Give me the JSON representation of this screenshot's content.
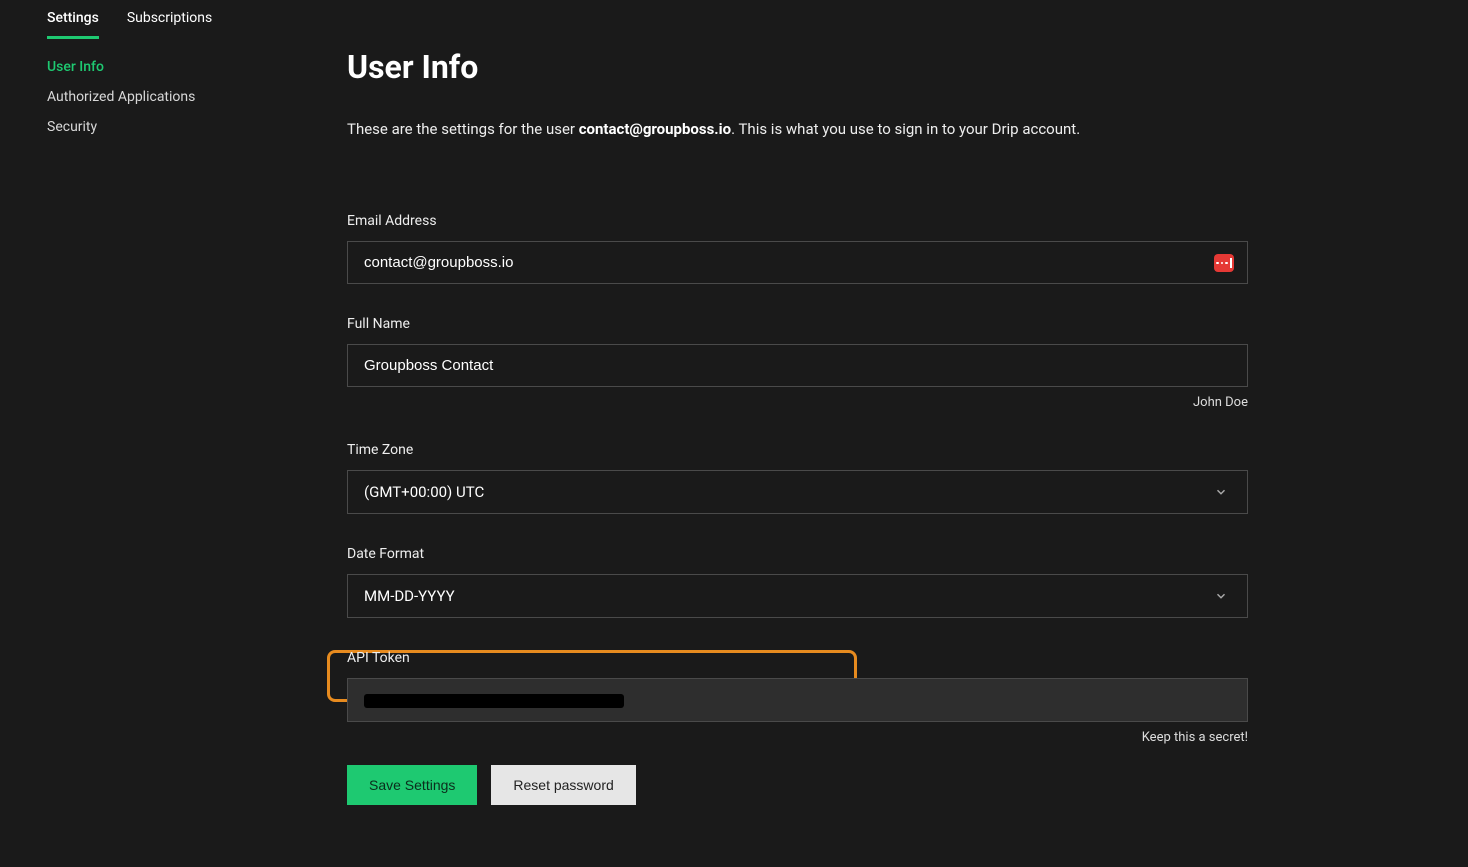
{
  "tabs": {
    "settings": "Settings",
    "subscriptions": "Subscriptions"
  },
  "sidebar": {
    "items": [
      {
        "label": "User Info",
        "active": true
      },
      {
        "label": "Authorized Applications",
        "active": false
      },
      {
        "label": "Security",
        "active": false
      }
    ]
  },
  "page": {
    "title": "User Info",
    "intro_prefix": "These are the settings for the user ",
    "intro_email": "contact@groupboss.io",
    "intro_suffix": ". This is what you use to sign in to your Drip account."
  },
  "fields": {
    "email": {
      "label": "Email Address",
      "value": "contact@groupboss.io"
    },
    "name": {
      "label": "Full Name",
      "value": "Groupboss Contact",
      "helper": "John Doe"
    },
    "timezone": {
      "label": "Time Zone",
      "value": "(GMT+00:00) UTC"
    },
    "dateformat": {
      "label": "Date Format",
      "value": "MM-DD-YYYY"
    },
    "api": {
      "label": "API Token",
      "helper": "Keep this a secret!"
    }
  },
  "buttons": {
    "save": "Save Settings",
    "reset": "Reset password"
  }
}
